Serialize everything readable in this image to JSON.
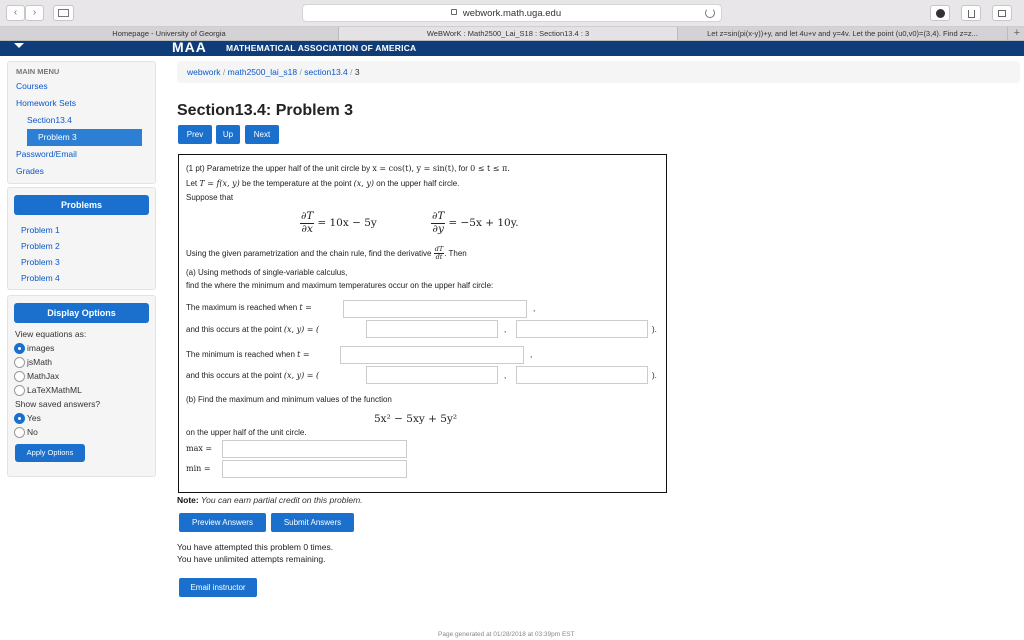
{
  "browser": {
    "url": "webwork.math.uga.edu",
    "back_glyph": "‹",
    "forward_glyph": "›",
    "tabs": [
      "Homepage - University of Georgia",
      "WeBWorK : Math2500_Lai_S18 : Section13.4 : 3",
      "Let z=sin(pi(x-y))+y, and let 4u+v and y=4v. Let the point (u0,v0)=(3,4). Find z=z..."
    ],
    "tab_add": "+"
  },
  "banner": {
    "mark": "MAA",
    "name": "MATHEMATICAL ASSOCIATION OF AMERICA"
  },
  "sidebar": {
    "menu_title": "MAIN MENU",
    "items": [
      "Courses",
      "Homework Sets",
      "Section13.4",
      "Problem 3",
      "Password/Email",
      "Grades"
    ],
    "problems_title": "Problems",
    "problems": [
      "Problem 1",
      "Problem 2",
      "Problem 3",
      "Problem 4"
    ],
    "display_title": "Display Options",
    "view_label": "View equations as:",
    "view_options": [
      "images",
      "jsMath",
      "MathJax",
      "LaTeXMathML"
    ],
    "saved_label": "Show saved answers?",
    "saved_options": [
      "Yes",
      "No"
    ],
    "apply_label": "Apply Options"
  },
  "breadcrumb": {
    "parts": [
      "webwork",
      "math2500_lai_s18",
      "section13.4",
      "3"
    ],
    "sep": "/"
  },
  "page_title": "Section13.4: Problem 3",
  "nav": {
    "prev": "Prev",
    "up": "Up",
    "next": "Next"
  },
  "problem": {
    "l1a": "(1 pt) Parametrize the upper half of the unit circle by ",
    "l1b": "x = cos(t), y = sin(t)",
    "l1c": ", for ",
    "l1d": "0 ≤ t ≤ π.",
    "l2a": "Let ",
    "l2b": "T = f(x, y)",
    "l2c": " be the temperature at the point ",
    "l2d": "(x, y)",
    "l2e": " on the upper half circle.",
    "l3": "Suppose that",
    "pd_num": "∂T",
    "pd_den_x": "∂x",
    "pd_den_y": "∂y",
    "eq1_rhs": "= 10x − 5y",
    "eq2_rhs": "= −5x + 10y.",
    "chain_a": "Using the given parametrization and the chain rule, find the derivative ",
    "dt_num": "dT",
    "dt_den": "dt",
    "chain_b": ". Then",
    "a_title": "(a) Using methods of single-variable calculus,",
    "a_sub": "find the where the minimum and maximum temperatures occur on the upper half circle:",
    "max_when": "The maximum is reached when ",
    "min_when": "The minimum is reached when ",
    "t_eq": "t =",
    "occurs": "and this occurs at the point ",
    "pt_eq": "(x, y) = (",
    "comma": ",",
    "close": ").",
    "b_title": "(b) Find the maximum and minimum values of the function",
    "func": "5x² − 5xy + 5y²",
    "b_sub": "on the upper half of the unit circle.",
    "max_label": "max =",
    "min_label": "min ="
  },
  "note": {
    "label": "Note:",
    "text": " You can earn partial credit on this problem."
  },
  "actions": {
    "preview": "Preview Answers",
    "submit": "Submit Answers",
    "email": "Email instructor"
  },
  "attempts": [
    "You have attempted this problem 0 times.",
    "You have unlimited attempts remaining."
  ],
  "footer": "Page generated at 01/28/2018 at 03:39pm EST"
}
